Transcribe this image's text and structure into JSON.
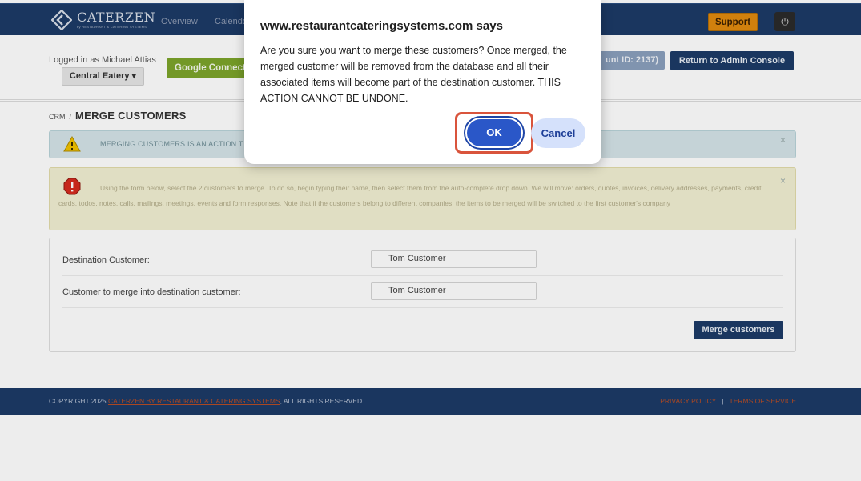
{
  "navbar": {
    "logo_name": "CATERZEN",
    "logo_sub": "by RESTAURANT & CATERING SYSTEMS",
    "links": [
      "Overview",
      "Calendar"
    ],
    "support_label": "Support",
    "power_icon": "power-icon"
  },
  "subheader": {
    "logged_in": "Logged in as Michael Attias",
    "location_button": "Central Eatery ▾",
    "google_connect": "Google Connect",
    "account_id": "unt ID: 2137)",
    "admin_console": "Return to Admin Console"
  },
  "breadcrumb": {
    "root": "CRM",
    "separator": "/",
    "title": "MERGE CUSTOMERS"
  },
  "alerts": {
    "info_text": "MERGING CUSTOMERS IS AN ACTION T",
    "info_close": "×",
    "warning_text": "Using the form below, select the 2 customers to merge. To do so, begin typing their name, then select them from the auto-complete drop down. We will move: orders, quotes, invoices, delivery addresses, payments, credit cards, todos, notes, calls, mailings, meetings, events and form responses. Note that if the customers belong to different companies, the items to be merged will be switched to the first customer's company",
    "warning_close": "×"
  },
  "form": {
    "destination_label": "Destination Customer:",
    "destination_value": "Tom Customer",
    "merge_label": "Customer to merge into destination customer:",
    "merge_value": "Tom Customer",
    "submit_label": "Merge customers"
  },
  "footer": {
    "copyright_prefix": "COPYRIGHT 2025 ",
    "copyright_link": "CATERZEN BY RESTAURANT & CATERING SYSTEMS",
    "copyright_suffix": ", ALL RIGHTS RESERVED.",
    "privacy": "PRIVACY POLICY",
    "divider": "|",
    "terms": "TERMS OF SERVICE"
  },
  "dialog": {
    "title": "www.restaurantcateringsystems.com says",
    "message": "Are you sure you want to merge these customers? Once merged, the merged customer will be removed from the database and all their associated items will become part of the destination customer. THIS ACTION CANNOT BE UNDONE.",
    "ok_label": "OK",
    "cancel_label": "Cancel"
  },
  "colors": {
    "navbar": "#1d3b67",
    "support": "#e08a0f",
    "google_connect": "#7ca42a",
    "ok_button": "#2a57c8",
    "highlight": "#d9543c"
  }
}
